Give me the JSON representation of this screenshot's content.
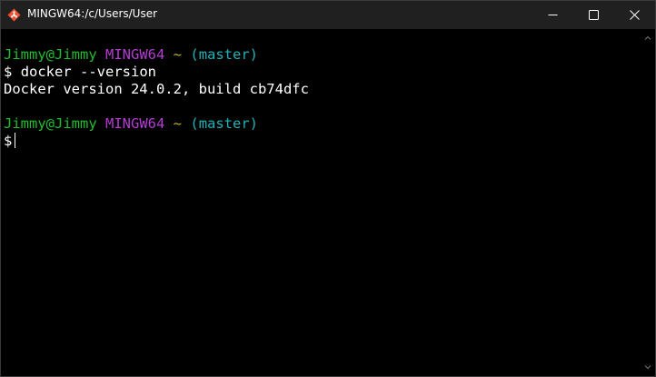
{
  "window": {
    "title": "MINGW64:/c/Users/User",
    "controls": {
      "minimize_icon": "minimize-icon",
      "maximize_icon": "maximize-icon",
      "close_icon": "close-icon"
    }
  },
  "terminal": {
    "prompt1": {
      "user_host": "Jimmy@Jimmy",
      "system": "MINGW64",
      "path": "~",
      "branch": "(master)"
    },
    "command_line": {
      "symbol": "$",
      "command": "docker --version"
    },
    "output": "Docker version 24.0.2, build cb74dfc",
    "prompt2": {
      "user_host": "Jimmy@Jimmy",
      "system": "MINGW64",
      "path": "~",
      "branch": "(master)"
    },
    "input_line": {
      "symbol": "$",
      "value": ""
    }
  },
  "colors": {
    "user_host": "#1fbd2f",
    "system": "#b53ad4",
    "path": "#c7b82a",
    "branch": "#1fb2b8",
    "titlebar": "#202020",
    "background": "#000000"
  }
}
